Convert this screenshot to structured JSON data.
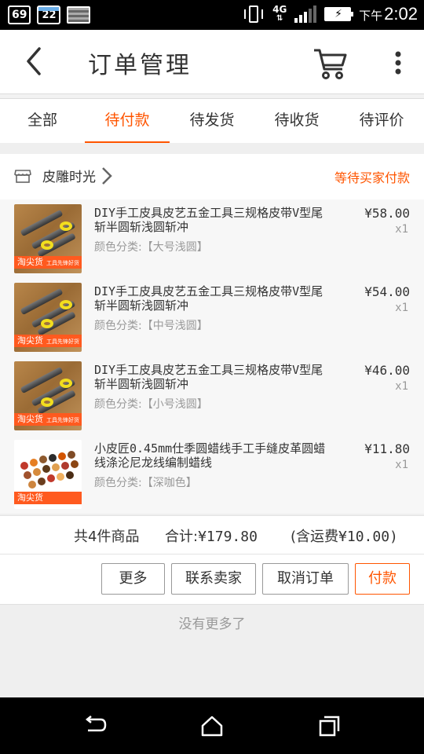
{
  "status_bar": {
    "badge": "69",
    "calendar_day": "22",
    "network": "4G",
    "time_prefix": "下午",
    "time": "2:02"
  },
  "header": {
    "title": "订单管理",
    "icons": [
      "back-arrow-icon",
      "cart-icon",
      "more-vertical-icon"
    ]
  },
  "tabs": [
    {
      "label": "全部",
      "active": false
    },
    {
      "label": "待付款",
      "active": true
    },
    {
      "label": "待发货",
      "active": false
    },
    {
      "label": "待收货",
      "active": false
    },
    {
      "label": "待评价",
      "active": false
    }
  ],
  "order": {
    "shop_name": "皮雕时光",
    "status": "等待买家付款",
    "items": [
      {
        "title": "DIY手工皮具皮艺五金工具三规格皮带V型尾斩半圆斩浅圆斩冲",
        "sku": "颜色分类:【大号浅圆】",
        "price": "¥58.00",
        "qty": "x1",
        "thumb_tag": "淘尖货",
        "thumb_sub": "工具先锋好货"
      },
      {
        "title": "DIY手工皮具皮艺五金工具三规格皮带V型尾斩半圆斩浅圆斩冲",
        "sku": "颜色分类:【中号浅圆】",
        "price": "¥54.00",
        "qty": "x1",
        "thumb_tag": "淘尖货",
        "thumb_sub": "工具先锋好货"
      },
      {
        "title": "DIY手工皮具皮艺五金工具三规格皮带V型尾斩半圆斩浅圆斩冲",
        "sku": "颜色分类:【小号浅圆】",
        "price": "¥46.00",
        "qty": "x1",
        "thumb_tag": "淘尖货",
        "thumb_sub": "工具先锋好货"
      },
      {
        "title": "小皮匠0.45mm仕季圆蜡线手工手缝皮革圆蜡线涤沦尼龙线编制蜡线",
        "sku": "颜色分类:【深咖色】",
        "price": "¥11.80",
        "qty": "x1",
        "thumb_tag": "淘尖货",
        "thumb_sub": ""
      }
    ],
    "summary": {
      "count": "共4件商品",
      "total_label": "合计:",
      "total_value": "¥179.80",
      "shipping_label": "(含运费",
      "shipping_value": "¥10.00)"
    },
    "buttons": {
      "more": "更多",
      "contact": "联系卖家",
      "cancel": "取消订单",
      "pay": "付款"
    }
  },
  "end_note": "没有更多了",
  "colors": {
    "accent": "#ff5500",
    "text": "#333333",
    "muted": "#999999"
  }
}
